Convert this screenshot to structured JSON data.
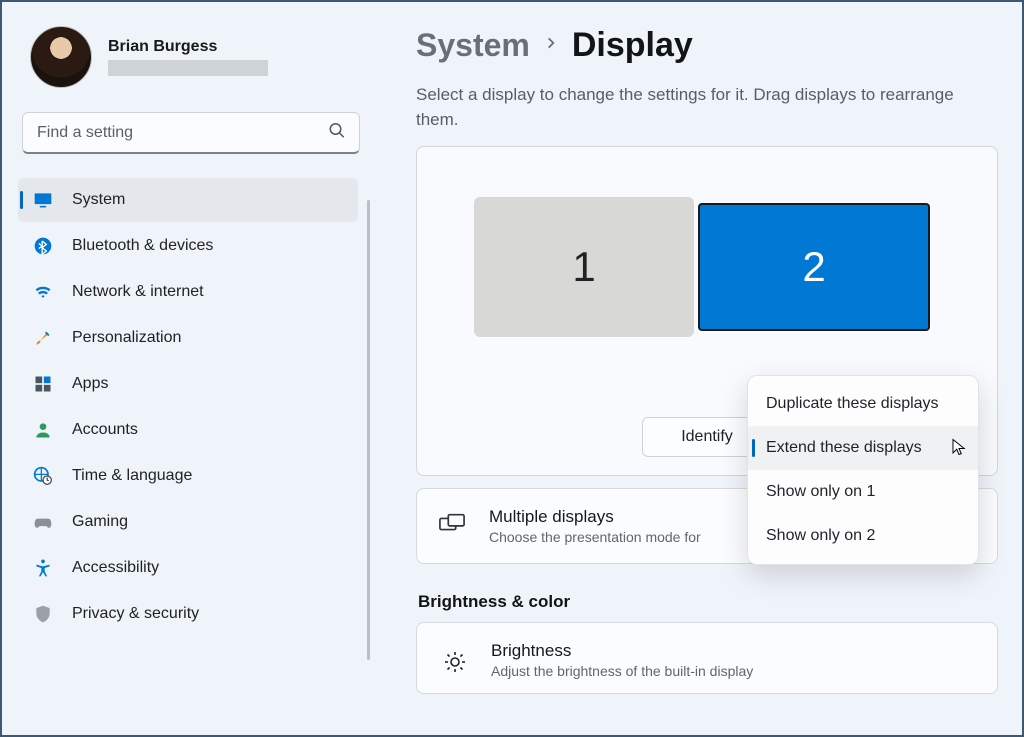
{
  "colors": {
    "accent": "#0067c0",
    "display_active": "#0078d4"
  },
  "user": {
    "name": "Brian Burgess"
  },
  "search": {
    "placeholder": "Find a setting"
  },
  "sidebar": {
    "items": [
      {
        "icon": "display-icon",
        "label": "System",
        "active": true
      },
      {
        "icon": "bluetooth-icon",
        "label": "Bluetooth & devices",
        "active": false
      },
      {
        "icon": "wifi-icon",
        "label": "Network & internet",
        "active": false
      },
      {
        "icon": "brush-icon",
        "label": "Personalization",
        "active": false
      },
      {
        "icon": "apps-icon",
        "label": "Apps",
        "active": false
      },
      {
        "icon": "account-icon",
        "label": "Accounts",
        "active": false
      },
      {
        "icon": "globe-clock-icon",
        "label": "Time & language",
        "active": false
      },
      {
        "icon": "gaming-icon",
        "label": "Gaming",
        "active": false
      },
      {
        "icon": "accessibility-icon",
        "label": "Accessibility",
        "active": false
      },
      {
        "icon": "shield-icon",
        "label": "Privacy & security",
        "active": false
      }
    ]
  },
  "breadcrumb": {
    "parent": "System",
    "current": "Display"
  },
  "arrangement": {
    "hint": "Select a display to change the settings for it. Drag displays to rearrange them.",
    "displays": [
      {
        "id": "1",
        "selected": false
      },
      {
        "id": "2",
        "selected": true
      }
    ],
    "identify_label": "Identify",
    "mode_options": [
      {
        "label": "Duplicate these displays",
        "selected": false
      },
      {
        "label": "Extend these displays",
        "selected": true
      },
      {
        "label": "Show only on 1",
        "selected": false
      },
      {
        "label": "Show only on 2",
        "selected": false
      }
    ]
  },
  "multiple_displays_card": {
    "title": "Multiple displays",
    "subtitle": "Choose the presentation mode for"
  },
  "section_brightness_heading": "Brightness & color",
  "brightness_card": {
    "title": "Brightness",
    "subtitle": "Adjust the brightness of the built-in display"
  }
}
